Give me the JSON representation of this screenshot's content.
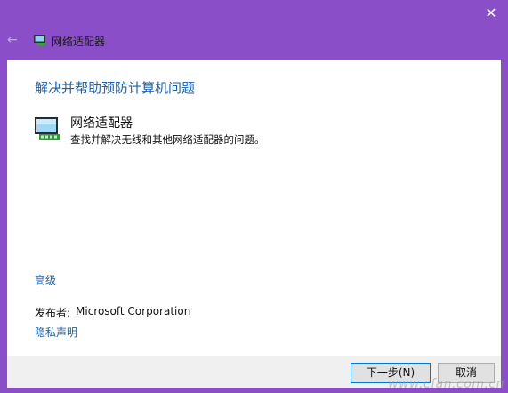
{
  "window": {
    "title": "网络适配器",
    "close_glyph": "✕",
    "back_glyph": "←"
  },
  "content": {
    "heading": "解决并帮助预防计算机问题",
    "item": {
      "title": "网络适配器",
      "description": "查找并解决无线和其他网络适配器的问题。",
      "icon": "network-adapter-icon"
    },
    "advanced_link": "高级",
    "publisher_label": "发布者:",
    "publisher_value": "Microsoft Corporation",
    "privacy_link": "隐私声明"
  },
  "footer": {
    "next_label": "下一步(N)",
    "cancel_label": "取消"
  },
  "watermark": "www.cfan.com.cn",
  "colors": {
    "titlebar": "#8a4fc8",
    "link": "#1e5fa8",
    "footer": "#f0f0f0"
  }
}
